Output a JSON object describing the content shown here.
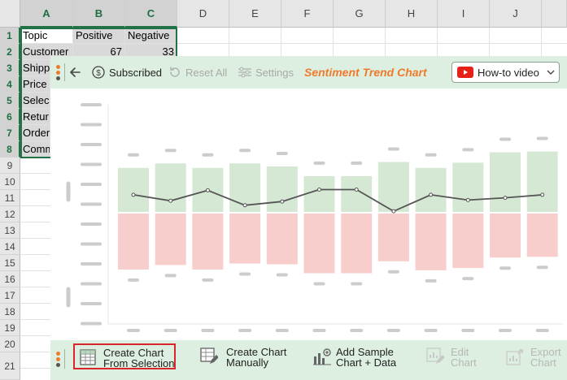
{
  "spreadsheet": {
    "columns": [
      "A",
      "B",
      "C",
      "D",
      "E",
      "F",
      "G",
      "H",
      "I",
      "J"
    ],
    "rows": [
      "1",
      "2",
      "3",
      "4",
      "5",
      "6",
      "7",
      "8",
      "9",
      "10",
      "11",
      "12",
      "13",
      "14",
      "15",
      "16",
      "17",
      "18",
      "19",
      "20",
      "21"
    ],
    "cells": {
      "a1": "Topic",
      "b1": "Positive",
      "c1": "Negative",
      "a2": "Customer",
      "b2": "67",
      "c2": "33",
      "a3": "Shipp",
      "a4": "Price",
      "a5": "Selec",
      "a6": "Retur",
      "a7": "Order",
      "a8": "Comm"
    }
  },
  "panel": {
    "toolbar": {
      "subscribed_label": "Subscribed",
      "reset_label": "Reset All",
      "settings_label": "Settings",
      "title": "Sentiment Trend Chart",
      "howto_label": "How-to video"
    },
    "bottom": {
      "create_selection_line1": "Create Chart",
      "create_selection_line2": "From Selection",
      "create_manual_line1": "Create Chart",
      "create_manual_line2": "Manually",
      "add_sample_line1": "Add Sample",
      "add_sample_line2": "Chart + Data",
      "edit_line1": "Edit",
      "edit_line2": "Chart",
      "export_line1": "Export",
      "export_line2": "Chart"
    }
  },
  "chart_data": {
    "type": "bar",
    "categories_count": 12,
    "positive": [
      60,
      66,
      60,
      66,
      62,
      49,
      49,
      68,
      60,
      67,
      81,
      82
    ],
    "negative": [
      -76,
      -70,
      -76,
      -68,
      -69,
      -81,
      -81,
      -65,
      -77,
      -74,
      -60,
      -59
    ],
    "trend": [
      24,
      16,
      30,
      10,
      15,
      31,
      31,
      2,
      24,
      17,
      20,
      24
    ],
    "ylim": [
      -100,
      100
    ],
    "colors": {
      "positive": "#d5e8d4",
      "negative": "#f8cecc",
      "line": "#555555",
      "placeholder": "#cccccc"
    }
  }
}
